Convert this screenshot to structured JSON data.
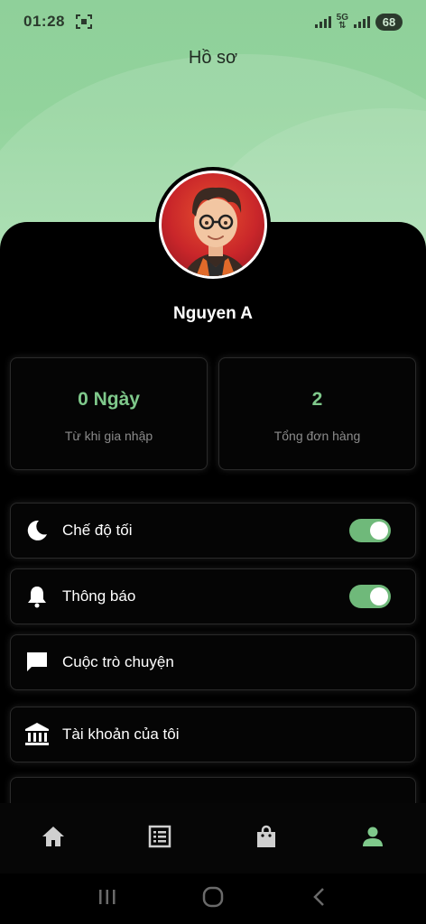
{
  "status_bar": {
    "time": "01:28",
    "network": "5G",
    "battery": "68"
  },
  "header": {
    "title": "Hồ sơ"
  },
  "profile": {
    "name": "Nguyen A"
  },
  "stats": [
    {
      "value": "0 Ngày",
      "label": "Từ khi gia nhập"
    },
    {
      "value": "2",
      "label": "Tổng đơn hàng"
    }
  ],
  "menu": {
    "dark_mode": {
      "label": "Chế độ tối",
      "icon": "moon-icon",
      "on": true
    },
    "notifications": {
      "label": "Thông báo",
      "icon": "bell-icon",
      "on": true
    },
    "chats": {
      "label": "Cuộc trò chuyện",
      "icon": "chat-icon"
    },
    "account": {
      "label": "Tài khoản của tôi",
      "icon": "bank-icon"
    }
  },
  "bottom_nav": [
    "home-icon",
    "list-icon",
    "shopping-bag-icon",
    "person-icon"
  ],
  "colors": {
    "accent": "#7fc98b",
    "toggle": "#6fb97a",
    "header_bg": "#92d39c"
  }
}
